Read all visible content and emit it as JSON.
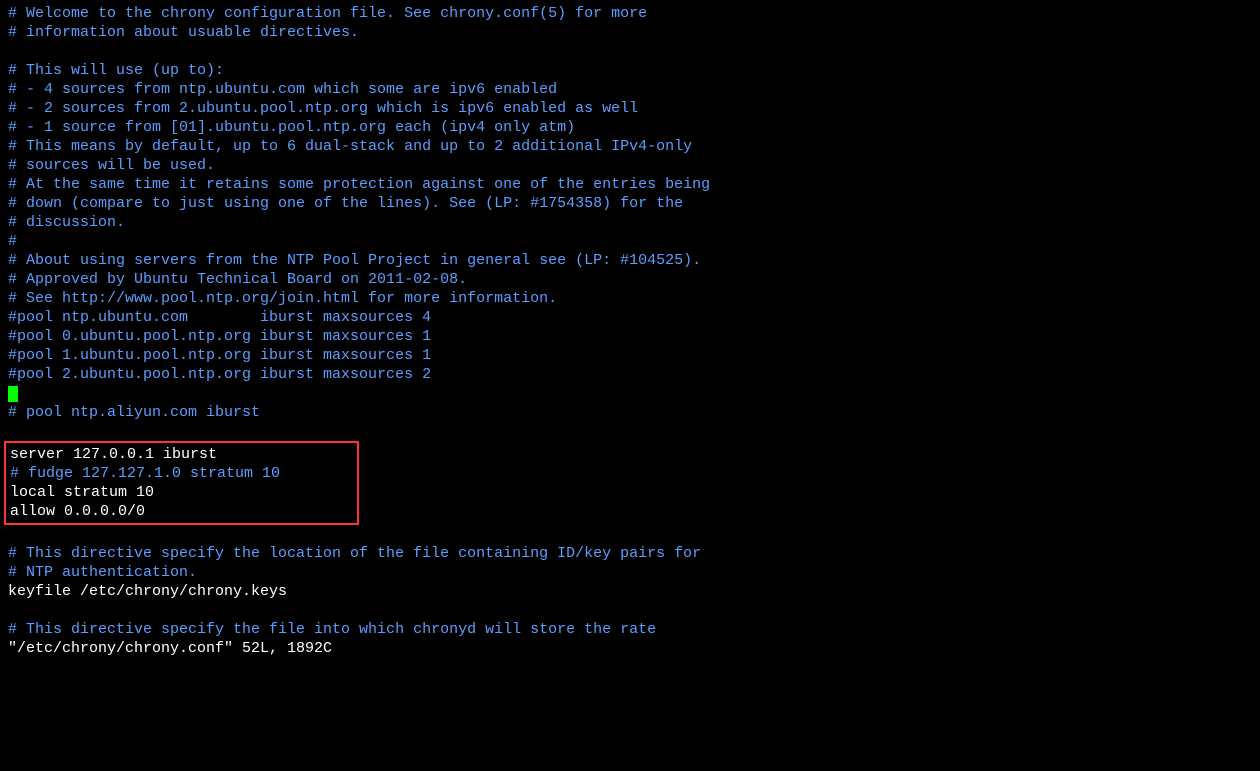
{
  "lines": [
    {
      "type": "comment",
      "text": "# Welcome to the chrony configuration file. See chrony.conf(5) for more"
    },
    {
      "type": "comment",
      "text": "# information about usuable directives."
    },
    {
      "type": "blank",
      "text": ""
    },
    {
      "type": "comment",
      "text": "# This will use (up to):"
    },
    {
      "type": "comment",
      "text": "# - 4 sources from ntp.ubuntu.com which some are ipv6 enabled"
    },
    {
      "type": "comment",
      "text": "# - 2 sources from 2.ubuntu.pool.ntp.org which is ipv6 enabled as well"
    },
    {
      "type": "comment",
      "text": "# - 1 source from [01].ubuntu.pool.ntp.org each (ipv4 only atm)"
    },
    {
      "type": "comment",
      "text": "# This means by default, up to 6 dual-stack and up to 2 additional IPv4-only"
    },
    {
      "type": "comment",
      "text": "# sources will be used."
    },
    {
      "type": "comment",
      "text": "# At the same time it retains some protection against one of the entries being"
    },
    {
      "type": "comment",
      "text": "# down (compare to just using one of the lines). See (LP: #1754358) for the"
    },
    {
      "type": "comment",
      "text": "# discussion."
    },
    {
      "type": "comment",
      "text": "#"
    },
    {
      "type": "comment",
      "text": "# About using servers from the NTP Pool Project in general see (LP: #104525)."
    },
    {
      "type": "comment",
      "text": "# Approved by Ubuntu Technical Board on 2011-02-08."
    },
    {
      "type": "comment",
      "text": "# See http://www.pool.ntp.org/join.html for more information."
    },
    {
      "type": "comment",
      "text": "#pool ntp.ubuntu.com        iburst maxsources 4"
    },
    {
      "type": "comment",
      "text": "#pool 0.ubuntu.pool.ntp.org iburst maxsources 1"
    },
    {
      "type": "comment",
      "text": "#pool 1.ubuntu.pool.ntp.org iburst maxsources 1"
    },
    {
      "type": "comment",
      "text": "#pool 2.ubuntu.pool.ntp.org iburst maxsources 2"
    },
    {
      "type": "cursor",
      "text": ""
    },
    {
      "type": "comment",
      "text": "# pool ntp.aliyun.com iburst"
    },
    {
      "type": "blank",
      "text": ""
    }
  ],
  "highlighted": [
    {
      "type": "plain",
      "text": "server 127.0.0.1 iburst"
    },
    {
      "type": "comment",
      "text": "# fudge 127.127.1.0 stratum 10"
    },
    {
      "type": "plain",
      "text": "local stratum 10"
    },
    {
      "type": "plain",
      "text": "allow 0.0.0.0/0"
    }
  ],
  "after": [
    {
      "type": "blank",
      "text": ""
    },
    {
      "type": "comment",
      "text": "# This directive specify the location of the file containing ID/key pairs for"
    },
    {
      "type": "comment",
      "text": "# NTP authentication."
    },
    {
      "type": "plain",
      "text": "keyfile /etc/chrony/chrony.keys"
    },
    {
      "type": "blank",
      "text": ""
    },
    {
      "type": "comment",
      "text": "# This directive specify the file into which chronyd will store the rate"
    }
  ],
  "status_line": "\"/etc/chrony/chrony.conf\" 52L, 1892C"
}
